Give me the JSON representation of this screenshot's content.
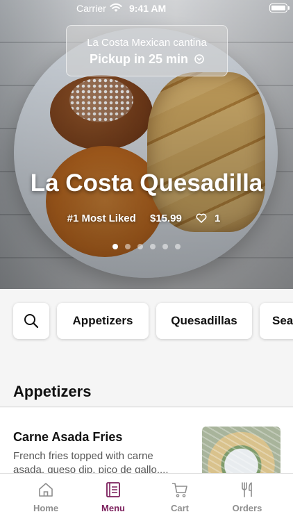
{
  "status_bar": {
    "carrier": "Carrier",
    "time": "9:41 AM"
  },
  "pickup": {
    "restaurant": "La Costa Mexican cantina",
    "pickup_text": "Pickup in 25 min"
  },
  "hero": {
    "title": "La Costa Quesadilla",
    "badge": "#1 Most Liked",
    "price": "$15.99",
    "likes": "1",
    "dots_total": 6,
    "dots_active": 1
  },
  "categories": {
    "items": [
      "Appetizers",
      "Quesadillas",
      "Sea"
    ]
  },
  "section": {
    "title": "Appetizers"
  },
  "menu_item": {
    "title": "Carne Asada Fries",
    "description": "French fries topped with carne asada, queso dip, pico de gallo...."
  },
  "tabs": [
    {
      "label": "Home",
      "icon": "home-icon"
    },
    {
      "label": "Menu",
      "icon": "menu-icon"
    },
    {
      "label": "Cart",
      "icon": "cart-icon"
    },
    {
      "label": "Orders",
      "icon": "fork-knife-icon"
    }
  ],
  "colors": {
    "accent": "#7b1f5c",
    "inactive": "#8e8e8e"
  }
}
